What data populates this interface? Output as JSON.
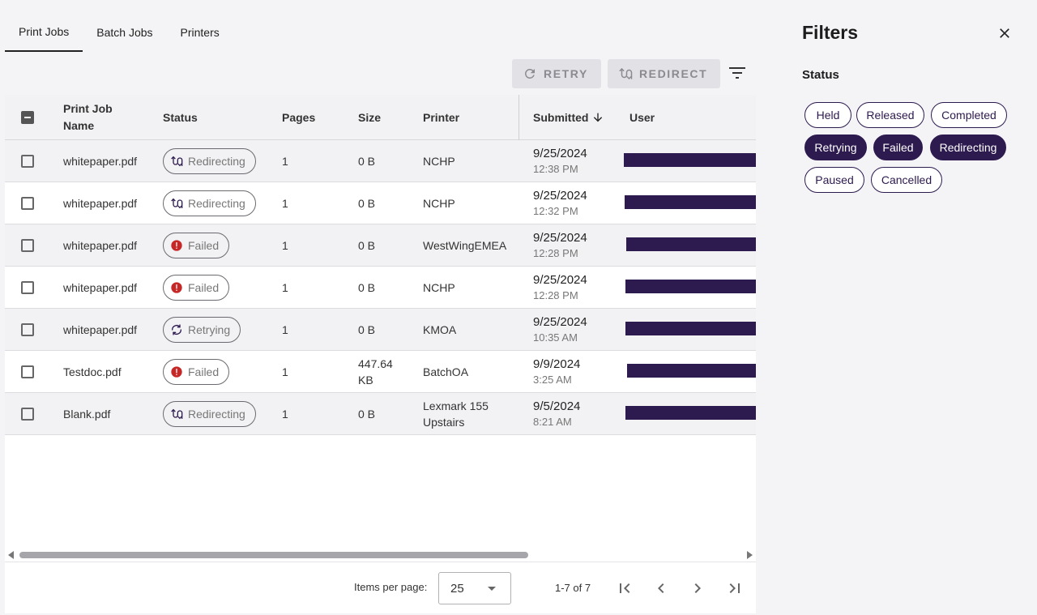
{
  "tabs": [
    "Print Jobs",
    "Batch Jobs",
    "Printers"
  ],
  "toolbar": {
    "retry_label": "RETRY",
    "redirect_label": "REDIRECT"
  },
  "table": {
    "headers": {
      "name": "Print Job Name",
      "status": "Status",
      "pages": "Pages",
      "size": "Size",
      "printer": "Printer",
      "submitted": "Submitted",
      "user": "User"
    },
    "sort": {
      "column": "Submitted",
      "direction": "descending"
    },
    "rows": [
      {
        "name": "whitepaper.pdf",
        "status": "Redirecting",
        "status_icon": "redirect-icon",
        "pages": "1",
        "size": "0 B",
        "printer": "NCHP",
        "date": "9/25/2024",
        "time": "12:38 PM",
        "user": ""
      },
      {
        "name": "whitepaper.pdf",
        "status": "Redirecting",
        "status_icon": "redirect-icon",
        "pages": "1",
        "size": "0 B",
        "printer": "NCHP",
        "date": "9/25/2024",
        "time": "12:32 PM",
        "user": ""
      },
      {
        "name": "whitepaper.pdf",
        "status": "Failed",
        "status_icon": "error-icon",
        "pages": "1",
        "size": "0 B",
        "printer": "WestWingEMEA",
        "date": "9/25/2024",
        "time": "12:28 PM",
        "user": ""
      },
      {
        "name": "whitepaper.pdf",
        "status": "Failed",
        "status_icon": "error-icon",
        "pages": "1",
        "size": "0 B",
        "printer": "NCHP",
        "date": "9/25/2024",
        "time": "12:28 PM",
        "user": ""
      },
      {
        "name": "whitepaper.pdf",
        "status": "Retrying",
        "status_icon": "retry-icon",
        "pages": "1",
        "size": "0 B",
        "printer": "KMOA",
        "date": "9/25/2024",
        "time": "10:35 AM",
        "user": ""
      },
      {
        "name": "Testdoc.pdf",
        "status": "Failed",
        "status_icon": "error-icon",
        "pages": "1",
        "size_line1": "447.64",
        "size_line2": "KB",
        "printer": "BatchOA",
        "date": "9/9/2024",
        "time": "3:25 AM",
        "user": ""
      },
      {
        "name": "Blank.pdf",
        "status": "Redirecting",
        "status_icon": "redirect-icon",
        "pages": "1",
        "size": "0 B",
        "printer_line1": "Lexmark 155",
        "printer_line2": "Upstairs",
        "date": "9/5/2024",
        "time": "8:21 AM",
        "user": ""
      }
    ]
  },
  "paginator": {
    "items_label": "Items per page:",
    "page_size": "25",
    "range": "1-7 of 7"
  },
  "filters": {
    "title": "Filters",
    "status_heading": "Status",
    "chips": [
      {
        "label": "Held",
        "selected": false
      },
      {
        "label": "Released",
        "selected": false
      },
      {
        "label": "Completed",
        "selected": false
      },
      {
        "label": "Retrying",
        "selected": true
      },
      {
        "label": "Failed",
        "selected": true
      },
      {
        "label": "Redirecting",
        "selected": true
      },
      {
        "label": "Paused",
        "selected": false
      },
      {
        "label": "Cancelled",
        "selected": false
      }
    ]
  },
  "colors": {
    "accent": "#2d1a4f",
    "error": "#c62828",
    "redacted_user": "#2d1a4f"
  }
}
